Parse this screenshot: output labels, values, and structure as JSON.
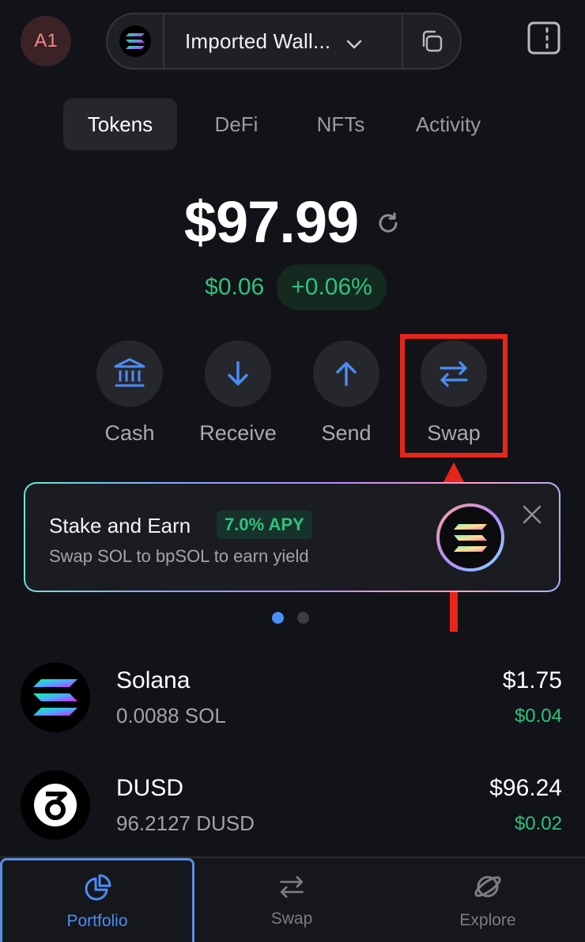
{
  "header": {
    "avatar_initials": "A1",
    "wallet_name": "Imported Wall...",
    "icons": [
      "solana-logo-icon",
      "chevron-down-icon",
      "copy-icon",
      "sidebar-toggle-icon"
    ]
  },
  "tabs": [
    {
      "label": "Tokens",
      "active": true
    },
    {
      "label": "DeFi",
      "active": false
    },
    {
      "label": "NFTs",
      "active": false
    },
    {
      "label": "Activity",
      "active": false
    }
  ],
  "balance": {
    "total": "$97.99",
    "change_usd": "$0.06",
    "change_pct": "+0.06%"
  },
  "actions": [
    {
      "label": "Cash",
      "icon": "bank-icon"
    },
    {
      "label": "Receive",
      "icon": "arrow-down-icon"
    },
    {
      "label": "Send",
      "icon": "arrow-up-icon"
    },
    {
      "label": "Swap",
      "icon": "swap-icon"
    }
  ],
  "promo": {
    "title": "Stake and Earn",
    "apy": "7.0% APY",
    "subtitle": "Swap SOL to bpSOL to earn yield"
  },
  "carousel": {
    "count": 2,
    "active_index": 0
  },
  "tokens": [
    {
      "name": "Solana",
      "amount": "0.0088 SOL",
      "value": "$1.75",
      "change": "$0.04"
    },
    {
      "name": "DUSD",
      "amount": "96.2127 DUSD",
      "value": "$96.24",
      "change": "$0.02"
    }
  ],
  "bottom_nav": [
    {
      "label": "Portfolio",
      "icon": "portfolio-icon",
      "active": true
    },
    {
      "label": "Swap",
      "icon": "swap-icon",
      "active": false
    },
    {
      "label": "Explore",
      "icon": "explore-icon",
      "active": false
    }
  ],
  "colors": {
    "background": "#121318",
    "accent": "#4b8ef5",
    "positive": "#2ec27e",
    "annotation": "#e8251b"
  }
}
